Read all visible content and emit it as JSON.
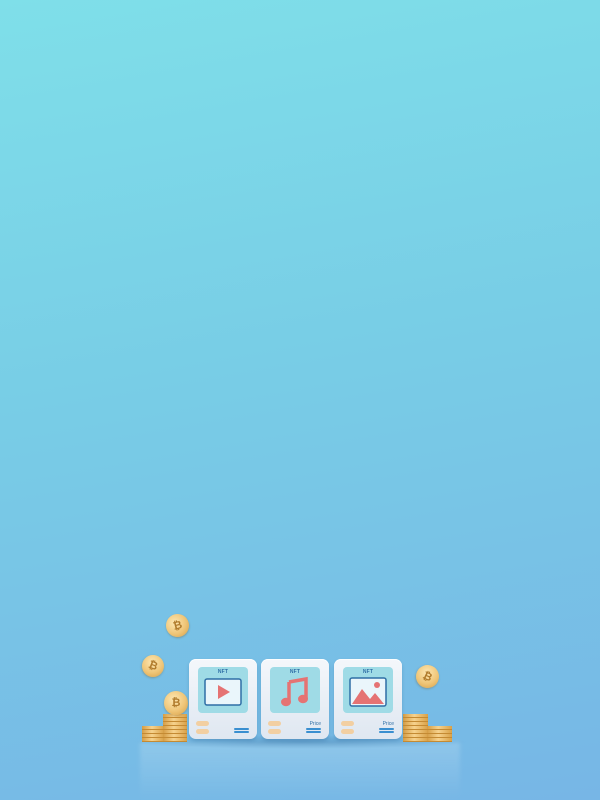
{
  "scene": {
    "description_free": true,
    "background_colors": [
      "#7fdfe9",
      "#77b6e6"
    ]
  },
  "cards": [
    {
      "tag": "NFT",
      "icon": "play-icon",
      "price": ""
    },
    {
      "tag": "NFT",
      "icon": "music-note-icon",
      "price": "Price"
    },
    {
      "tag": "NFT",
      "icon": "image-icon",
      "price": "Price"
    }
  ],
  "coins": {
    "symbol": "₿",
    "accent": "#efc577"
  }
}
